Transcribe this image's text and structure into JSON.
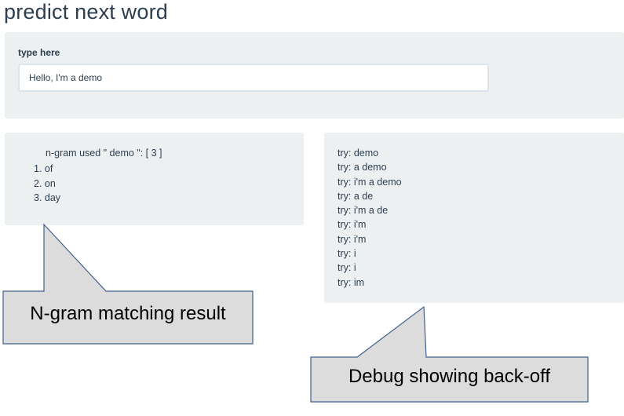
{
  "app": {
    "title": "predict next word"
  },
  "input": {
    "label": "type here",
    "value": "Hello, I'm a demo"
  },
  "result": {
    "header": "n-gram used \" demo \": [ 3 ]",
    "items": [
      "1. of",
      "2. on",
      "3. day"
    ]
  },
  "debug": {
    "lines": [
      "try: demo",
      "try: a demo",
      "try: i'm a demo",
      "try: a de",
      "try: i'm a de",
      "try: i'm",
      "try: i'm",
      "try: i",
      "try: i",
      "try: im"
    ]
  },
  "callouts": {
    "ngram_label": "N-gram matching result",
    "debug_label": "Debug showing back-off",
    "fill_color": "#dcdcdc",
    "border_color": "#41608c"
  }
}
